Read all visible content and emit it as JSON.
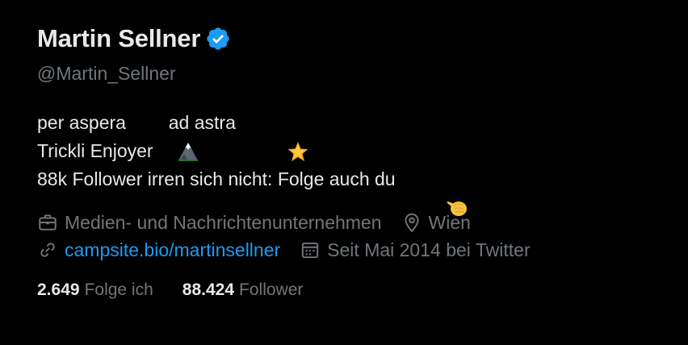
{
  "profile": {
    "display_name": "Martin Sellner",
    "handle": "@Martin_Sellner",
    "verified": true,
    "verified_color": "#1d9bf0"
  },
  "bio": {
    "line1_part1": "per aspera ",
    "line1_emoji1": "mountain-emoji",
    "line1_part2": " ad astra ",
    "line1_emoji2": "star-emoji",
    "line2": "Trickli Enjoyer",
    "line3": "88k Follower irren sich nicht: Folge auch du ",
    "line3_emoji": "pointing-hand-emoji"
  },
  "meta": {
    "category_icon": "briefcase-icon",
    "category": "Medien- und Nachrichtenunternehmen",
    "location_icon": "location-pin-icon",
    "location": "Wien",
    "link_icon": "link-icon",
    "link": "campsite.bio/martinsellner",
    "joined_icon": "calendar-icon",
    "joined": "Seit Mai 2014 bei Twitter"
  },
  "stats": {
    "following_count": "2.649",
    "following_label": "Folge ich",
    "followers_count": "88.424",
    "followers_label": "Follower"
  },
  "colors": {
    "background": "#000000",
    "primary_text": "#e7e9ea",
    "secondary_text": "#71767b",
    "link": "#1d9bf0"
  }
}
